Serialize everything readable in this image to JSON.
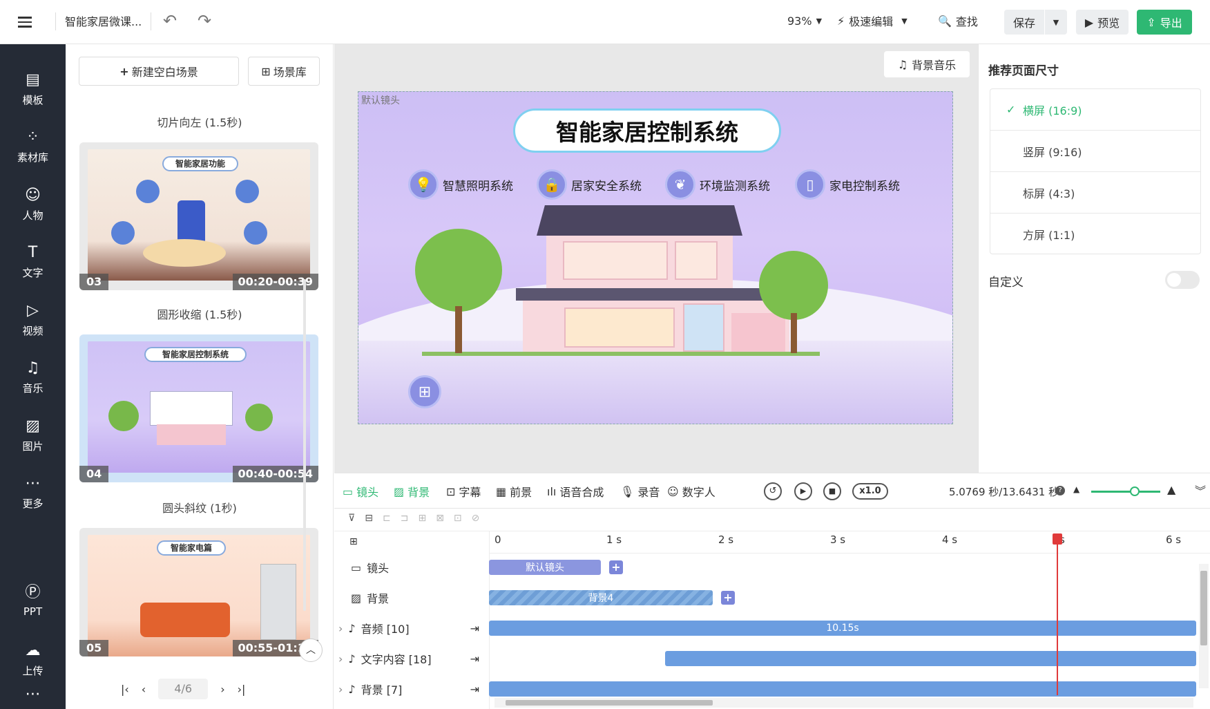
{
  "topbar": {
    "project_title": "智能家居微课...",
    "zoom": "93%",
    "mode": "极速编辑",
    "find": "查找",
    "save": "保存",
    "preview": "预览",
    "export": "导出"
  },
  "nav": {
    "items": [
      {
        "label": "模板",
        "icon": "template-icon"
      },
      {
        "label": "素材库",
        "icon": "materials-icon"
      },
      {
        "label": "人物",
        "icon": "person-icon"
      },
      {
        "label": "文字",
        "icon": "text-icon"
      },
      {
        "label": "视频",
        "icon": "video-icon"
      },
      {
        "label": "音乐",
        "icon": "music-icon"
      },
      {
        "label": "图片",
        "icon": "image-icon"
      },
      {
        "label": "更多",
        "icon": "more-icon"
      },
      {
        "label": "PPT",
        "icon": "ppt-icon"
      },
      {
        "label": "上传",
        "icon": "upload-icon"
      }
    ]
  },
  "scenes": {
    "new_scene": "新建空白场景",
    "library": "场景库",
    "items": [
      {
        "transition": "切片向左 (1.5秒)",
        "num": "03",
        "time": "00:20-00:39",
        "title": "智能家居功能"
      },
      {
        "transition": "圆形收缩 (1.5秒)",
        "num": "04",
        "time": "00:40-00:54",
        "title": "智能家居控制系统"
      },
      {
        "transition": "圆头斜纹 (1秒)",
        "num": "05",
        "time": "00:55-01:15",
        "title": "智能家电篇"
      }
    ],
    "pagination": "4/6"
  },
  "canvas": {
    "bg_music": "背景音乐",
    "camera_label": "默认镜头",
    "slide_title": "智能家居控制系统",
    "features": [
      "智慧照明系统",
      "居家安全系统",
      "环境监测系统",
      "家电控制系统"
    ]
  },
  "rightpanel": {
    "title": "推荐页面尺寸",
    "options": [
      "横屏 (16:9)",
      "竖屏 (9:16)",
      "标屏 (4:3)",
      "方屏 (1:1)"
    ],
    "custom": "自定义"
  },
  "timeline_toolbar": {
    "tools": [
      "镜头",
      "背景",
      "字幕",
      "前景",
      "语音合成",
      "录音",
      "数字人"
    ],
    "speed": "x1.0",
    "time": "5.0769 秒/13.6431 秒"
  },
  "timeline": {
    "ruler": [
      "0",
      "1 s",
      "2 s",
      "3 s",
      "4 s",
      "s",
      "6 s"
    ],
    "tracks": [
      {
        "label": "镜头",
        "bar": "默认镜头"
      },
      {
        "label": "背景",
        "bar": "背景4"
      },
      {
        "label": "音频 [10]",
        "bar": "10.15s"
      },
      {
        "label": "文字内容 [18]",
        "bar": ""
      },
      {
        "label": "背景 [7]",
        "bar": ""
      }
    ]
  }
}
